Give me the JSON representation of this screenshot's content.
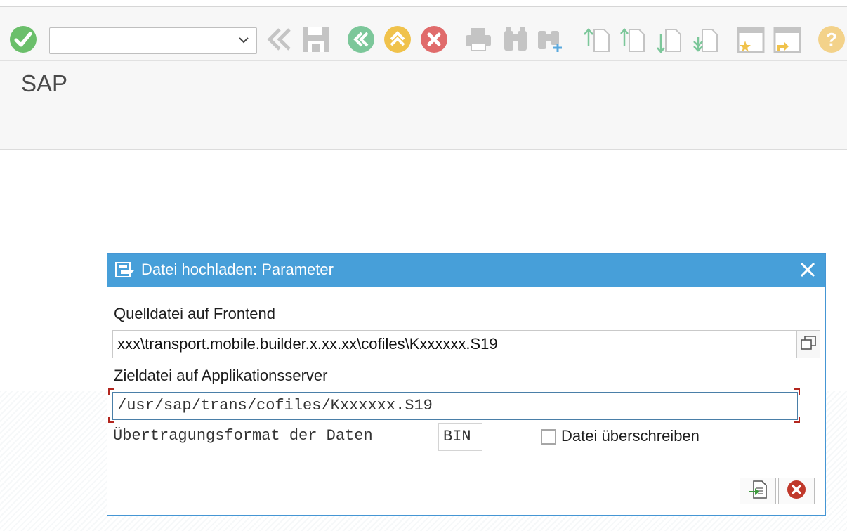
{
  "toolbar": {
    "command_field_value": "",
    "icons": [
      "enter-icon",
      "back-double-icon",
      "save-icon",
      "back-icon",
      "exit-icon",
      "cancel-icon",
      "print-icon",
      "find-icon",
      "find-next-icon",
      "first-page-icon",
      "previous-page-icon",
      "next-page-icon",
      "last-page-icon",
      "create-session-icon",
      "shortcut-icon",
      "help-icon"
    ]
  },
  "header": {
    "title": "SAP"
  },
  "dialog": {
    "title": "Datei hochladen: Parameter",
    "source_label": "Quelldatei auf Frontend",
    "source_value": "xxx\\transport.mobile.builder.x.xx.xx\\cofiles\\Kxxxxxx.S19",
    "target_label": "Zieldatei auf Applikationsserver",
    "target_value": "/usr/sap/trans/cofiles/Kxxxxxx.S19",
    "format_label": "Übertragungsformat der Daten",
    "format_value": "BIN",
    "overwrite_label": "Datei überschreiben",
    "overwrite_checked": false
  },
  "colors": {
    "dialog_header": "#479fd9",
    "accent_green": "#5cb85c",
    "accent_yellow": "#f0c24b",
    "accent_red": "#d9534f"
  }
}
